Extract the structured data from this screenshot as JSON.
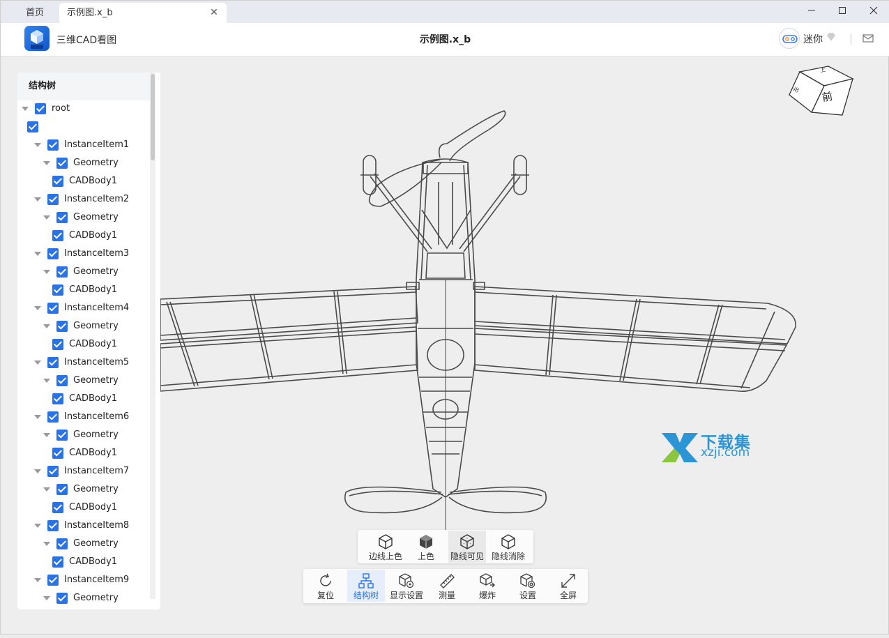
{
  "tabs": {
    "home": "首页",
    "active": "示例图.x_b",
    "close_glyph": "✕"
  },
  "window_controls": {
    "minimize": "—",
    "maximize": "☐",
    "close": "✕"
  },
  "header": {
    "app_name": "三维CAD看图",
    "doc_title": "示例图.x_b",
    "user_name": "迷你",
    "logo_text": "CAD"
  },
  "sidebar": {
    "title": "结构树",
    "rows": [
      {
        "label": "root",
        "caret": true,
        "indent": 0
      },
      {
        "label": "",
        "caret": false,
        "indent": 1
      },
      {
        "label": "InstanceItem1",
        "caret": true,
        "indent": 2
      },
      {
        "label": "Geometry",
        "caret": true,
        "indent": 3
      },
      {
        "label": "CADBody1",
        "caret": false,
        "indent": 4
      },
      {
        "label": "InstanceItem2",
        "caret": true,
        "indent": 2
      },
      {
        "label": "Geometry",
        "caret": true,
        "indent": 3
      },
      {
        "label": "CADBody1",
        "caret": false,
        "indent": 4
      },
      {
        "label": "InstanceItem3",
        "caret": true,
        "indent": 2
      },
      {
        "label": "Geometry",
        "caret": true,
        "indent": 3
      },
      {
        "label": "CADBody1",
        "caret": false,
        "indent": 4
      },
      {
        "label": "InstanceItem4",
        "caret": true,
        "indent": 2
      },
      {
        "label": "Geometry",
        "caret": true,
        "indent": 3
      },
      {
        "label": "CADBody1",
        "caret": false,
        "indent": 4
      },
      {
        "label": "InstanceItem5",
        "caret": true,
        "indent": 2
      },
      {
        "label": "Geometry",
        "caret": true,
        "indent": 3
      },
      {
        "label": "CADBody1",
        "caret": false,
        "indent": 4
      },
      {
        "label": "InstanceItem6",
        "caret": true,
        "indent": 2
      },
      {
        "label": "Geometry",
        "caret": true,
        "indent": 3
      },
      {
        "label": "CADBody1",
        "caret": false,
        "indent": 4
      },
      {
        "label": "InstanceItem7",
        "caret": true,
        "indent": 2
      },
      {
        "label": "Geometry",
        "caret": true,
        "indent": 3
      },
      {
        "label": "CADBody1",
        "caret": false,
        "indent": 4
      },
      {
        "label": "InstanceItem8",
        "caret": true,
        "indent": 2
      },
      {
        "label": "Geometry",
        "caret": true,
        "indent": 3
      },
      {
        "label": "CADBody1",
        "caret": false,
        "indent": 4
      },
      {
        "label": "InstanceItem9",
        "caret": true,
        "indent": 2
      },
      {
        "label": "Geometry",
        "caret": true,
        "indent": 3
      }
    ]
  },
  "viewcube": {
    "front_label": "前",
    "right_label": "左",
    "top_label": "上"
  },
  "render_modes": [
    {
      "label": "边线上色",
      "icon": "cube-edges-shaded-icon",
      "active": false
    },
    {
      "label": "上色",
      "icon": "cube-shaded-icon",
      "active": false
    },
    {
      "label": "隐线可见",
      "icon": "cube-hidden-lines-visible-icon",
      "active": true
    },
    {
      "label": "隐线消除",
      "icon": "cube-hidden-lines-removed-icon",
      "active": false
    }
  ],
  "toolbar": [
    {
      "label": "复位",
      "icon": "reset-icon",
      "active": false
    },
    {
      "label": "结构树",
      "icon": "structure-tree-icon",
      "active": true
    },
    {
      "label": "显示设置",
      "icon": "display-settings-icon",
      "active": false
    },
    {
      "label": "测量",
      "icon": "ruler-icon",
      "active": false
    },
    {
      "label": "爆炸",
      "icon": "explode-icon",
      "active": false
    },
    {
      "label": "设置",
      "icon": "settings-icon",
      "active": false
    },
    {
      "label": "全屏",
      "icon": "fullscreen-icon",
      "active": false
    }
  ],
  "watermark": {
    "cn": "下载集",
    "en": "xzji.com"
  },
  "colors": {
    "accent": "#2a73e6",
    "checkbox": "#2a73e6",
    "watermark": "#2b95d6",
    "viewport_bg": "#eeeeee"
  }
}
